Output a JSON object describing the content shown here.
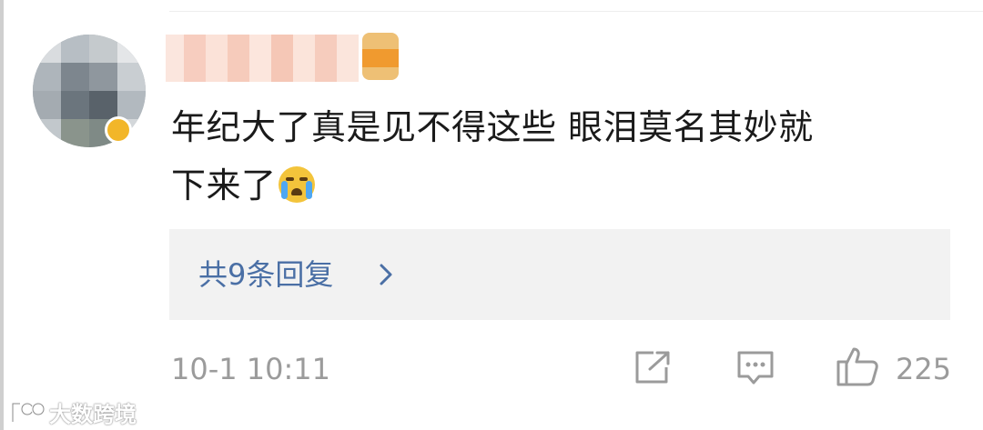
{
  "comment": {
    "text_line1": "年纪大了真是见不得这些 眼泪莫名其妙就",
    "text_line2": "下来了",
    "emoji_icon": "crying-face-emoji"
  },
  "replies": {
    "label": "共9条回复",
    "chevron_icon": "chevron-right-icon"
  },
  "footer": {
    "timestamp": "10-1 10:11",
    "share_icon": "share-icon",
    "comment_icon": "comment-icon",
    "like_icon": "thumbs-up-icon",
    "like_count": "225"
  },
  "watermark": {
    "text": "大数跨境"
  },
  "colors": {
    "link": "#4a6fa5",
    "meta": "#9b9b9b",
    "reply_bg": "#f2f2f2",
    "badge": "#f2b629"
  }
}
